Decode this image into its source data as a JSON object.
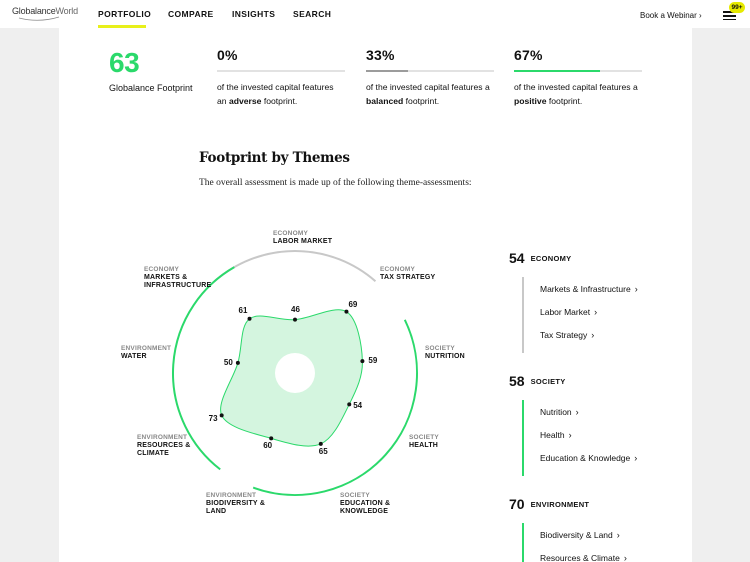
{
  "nav": {
    "logo_main": "Globalance",
    "logo_sub": "World",
    "items": [
      "PORTFOLIO",
      "COMPARE",
      "INSIGHTS",
      "SEARCH"
    ],
    "webinar": "Book a Webinar",
    "badge": "99+"
  },
  "summary": {
    "score": "63",
    "score_label": "Globalance Footprint",
    "stats": [
      {
        "pct": "0%",
        "fill": 0,
        "color": "#e24b4b",
        "pre": "of the invested capital features an ",
        "bold": "adverse",
        "post": " footprint."
      },
      {
        "pct": "33%",
        "fill": 33,
        "color": "#9c9c9c",
        "pre": "of the invested capital features a ",
        "bold": "balanced",
        "post": " footprint."
      },
      {
        "pct": "67%",
        "fill": 67,
        "color": "#2bd96b",
        "pre": "of the invested capital features a ",
        "bold": "positive",
        "post": " footprint."
      }
    ]
  },
  "themes": {
    "title": "Footprint by Themes",
    "subtitle": "The overall assessment is made up of the following theme-assessments:"
  },
  "chart_data": {
    "type": "radar",
    "range": [
      0,
      100
    ],
    "axes": [
      {
        "category": "ECONOMY",
        "name": "LABOR MARKET",
        "value": 46
      },
      {
        "category": "ECONOMY",
        "name": "TAX STRATEGY",
        "value": 69
      },
      {
        "category": "SOCIETY",
        "name": "NUTRITION",
        "value": 59
      },
      {
        "category": "SOCIETY",
        "name": "HEALTH",
        "value": 54
      },
      {
        "category": "SOCIETY",
        "name": "EDUCATION & KNOWLEDGE",
        "value": 65
      },
      {
        "category": "ENVIRONMENT",
        "name": "BIODIVERSITY & LAND",
        "value": 60
      },
      {
        "category": "ENVIRONMENT",
        "name": "RESOURCES & CLIMATE",
        "value": 73
      },
      {
        "category": "ENVIRONMENT",
        "name": "WATER",
        "value": 50
      },
      {
        "category": "ECONOMY",
        "name": "MARKETS & INFRASTRUCTURE",
        "value": 61
      }
    ],
    "colors": {
      "fill": "#d4f5df",
      "stroke": "#2bd96b",
      "economy_arc": "#c8c8c8",
      "green_arc": "#2bd96b"
    }
  },
  "groups": [
    {
      "score": "54",
      "name": "ECONOMY",
      "line_color": "#c8c8c8",
      "items": [
        "Markets & Infrastructure",
        "Labor Market",
        "Tax Strategy"
      ]
    },
    {
      "score": "58",
      "name": "SOCIETY",
      "line_color": "#2bd96b",
      "items": [
        "Nutrition",
        "Health",
        "Education & Knowledge"
      ]
    },
    {
      "score": "70",
      "name": "ENVIRONMENT",
      "line_color": "#2bd96b",
      "items": [
        "Biodiversity & Land",
        "Resources & Climate"
      ]
    }
  ]
}
